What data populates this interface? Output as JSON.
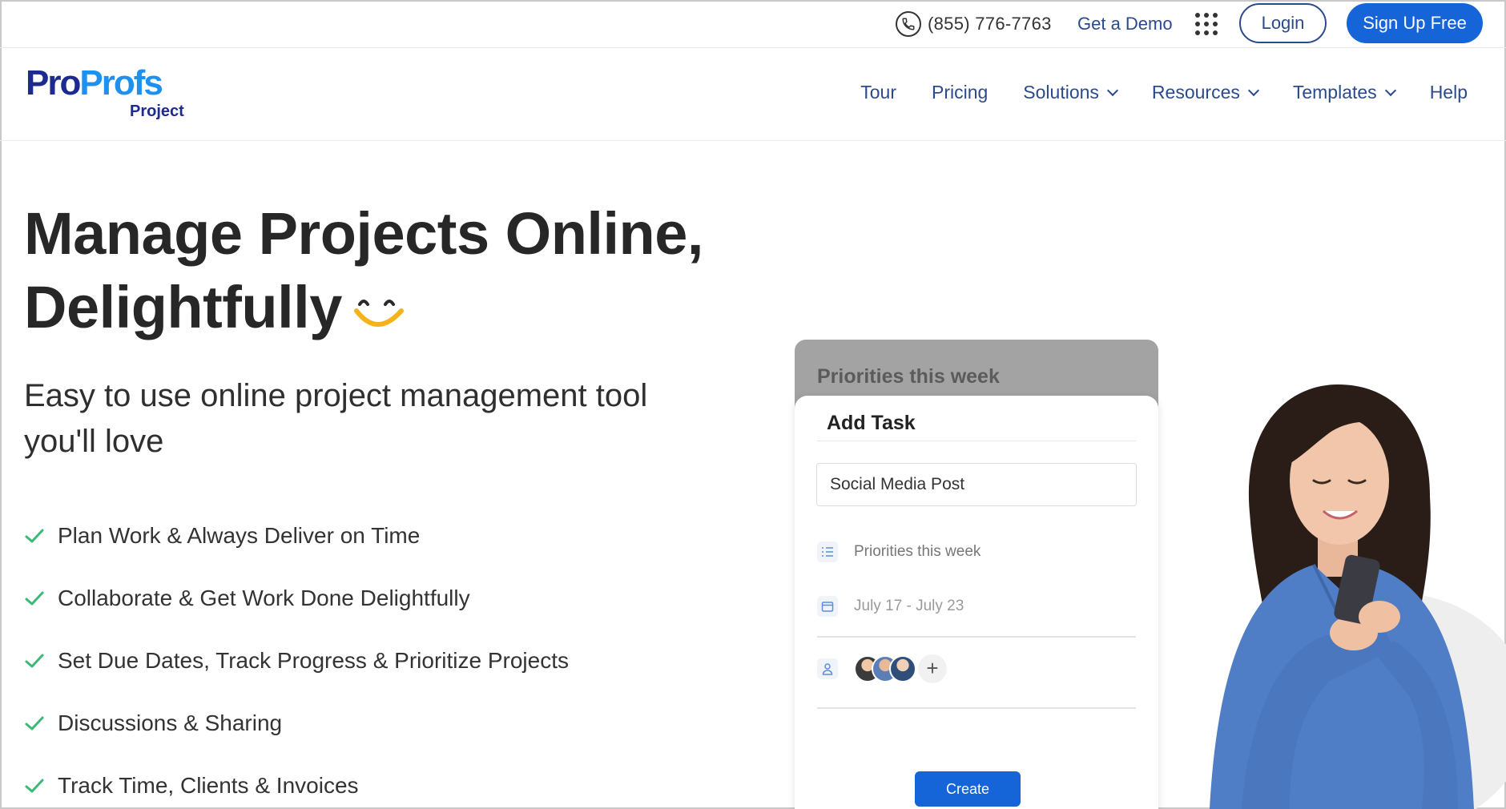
{
  "topbar": {
    "phone_number": "(855) 776-7763",
    "demo_label": "Get a Demo",
    "login_label": "Login",
    "signup_label": "Sign Up Free"
  },
  "brand": {
    "logo_pro": "Pro",
    "logo_profs": "Profs",
    "logo_sub": "Project"
  },
  "nav": {
    "items": [
      {
        "label": "Tour"
      },
      {
        "label": "Pricing"
      },
      {
        "label": "Solutions"
      },
      {
        "label": "Resources"
      },
      {
        "label": "Templates"
      },
      {
        "label": "Help"
      }
    ]
  },
  "hero": {
    "title_line1": "Manage Projects Online,",
    "title_line2": "Delightfully",
    "subtitle": "Easy to use online project management tool you'll love",
    "features": [
      "Plan Work & Always Deliver on Time",
      "Collaborate & Get Work Done Delightfully",
      "Set Due Dates, Track Progress & Prioritize Projects",
      "Discussions & Sharing",
      "Track Time, Clients & Invoices"
    ]
  },
  "task_card": {
    "back_title": "Priorities this week",
    "title": "Add Task",
    "task_name_value": "Social Media Post",
    "list_name": "Priorities this week",
    "date_range": "July 17 - July 23",
    "add_member_symbol": "+",
    "create_label": "Create"
  },
  "colors": {
    "brand_blue": "#1565d8",
    "nav_blue": "#2b4a8c",
    "logo_dark": "#1d2a8f",
    "logo_light": "#1e90f0",
    "check_green": "#3cb878",
    "smile_yellow": "#f5b21b"
  }
}
